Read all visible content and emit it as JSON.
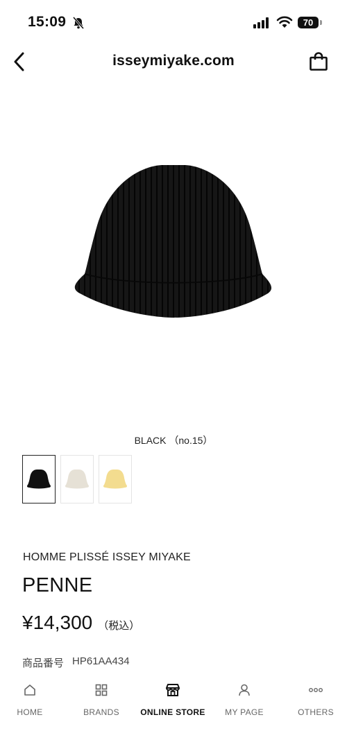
{
  "status_bar": {
    "time": "15:09",
    "battery": "70"
  },
  "nav": {
    "title": "isseymiyake.com"
  },
  "product": {
    "color_label": "BLACK （no.15）",
    "swatches": [
      {
        "name": "black",
        "color": "#111111",
        "selected": true
      },
      {
        "name": "ivory",
        "color": "#e6e1d6",
        "selected": false
      },
      {
        "name": "yellow",
        "color": "#f3dc8f",
        "selected": false
      }
    ],
    "brand": "HOMME PLISSÉ ISSEY MIYAKE",
    "name": "PENNE",
    "price": "¥14,300",
    "tax_note": "（税込）",
    "sku_label": "商品番号",
    "sku": "HP61AA434"
  },
  "tab_bar": {
    "items": [
      {
        "label": "HOME",
        "icon": "home-icon"
      },
      {
        "label": "BRANDS",
        "icon": "grid-icon"
      },
      {
        "label": "ONLINE STORE",
        "icon": "store-icon",
        "active": true
      },
      {
        "label": "MY PAGE",
        "icon": "person-icon"
      },
      {
        "label": "OTHERS",
        "icon": "more-icon"
      }
    ]
  }
}
